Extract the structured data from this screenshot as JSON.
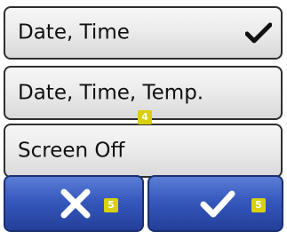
{
  "options": [
    {
      "label": "Date, Time",
      "selected": true
    },
    {
      "label": "Date, Time, Temp.",
      "selected": false
    },
    {
      "label": "Screen Off",
      "selected": false
    }
  ],
  "badges": {
    "middle": "4",
    "cancel": "5",
    "confirm": "5"
  },
  "icons": {
    "selected": "check-icon",
    "cancel": "x-icon",
    "confirm": "check-icon"
  },
  "colors": {
    "option_background": "#ececec",
    "option_border": "#2f2f2f",
    "button_blue": "#3658bd",
    "badge_yellow": "#d8d10b",
    "icon_white": "#ffffff",
    "icon_dark": "#111111"
  }
}
